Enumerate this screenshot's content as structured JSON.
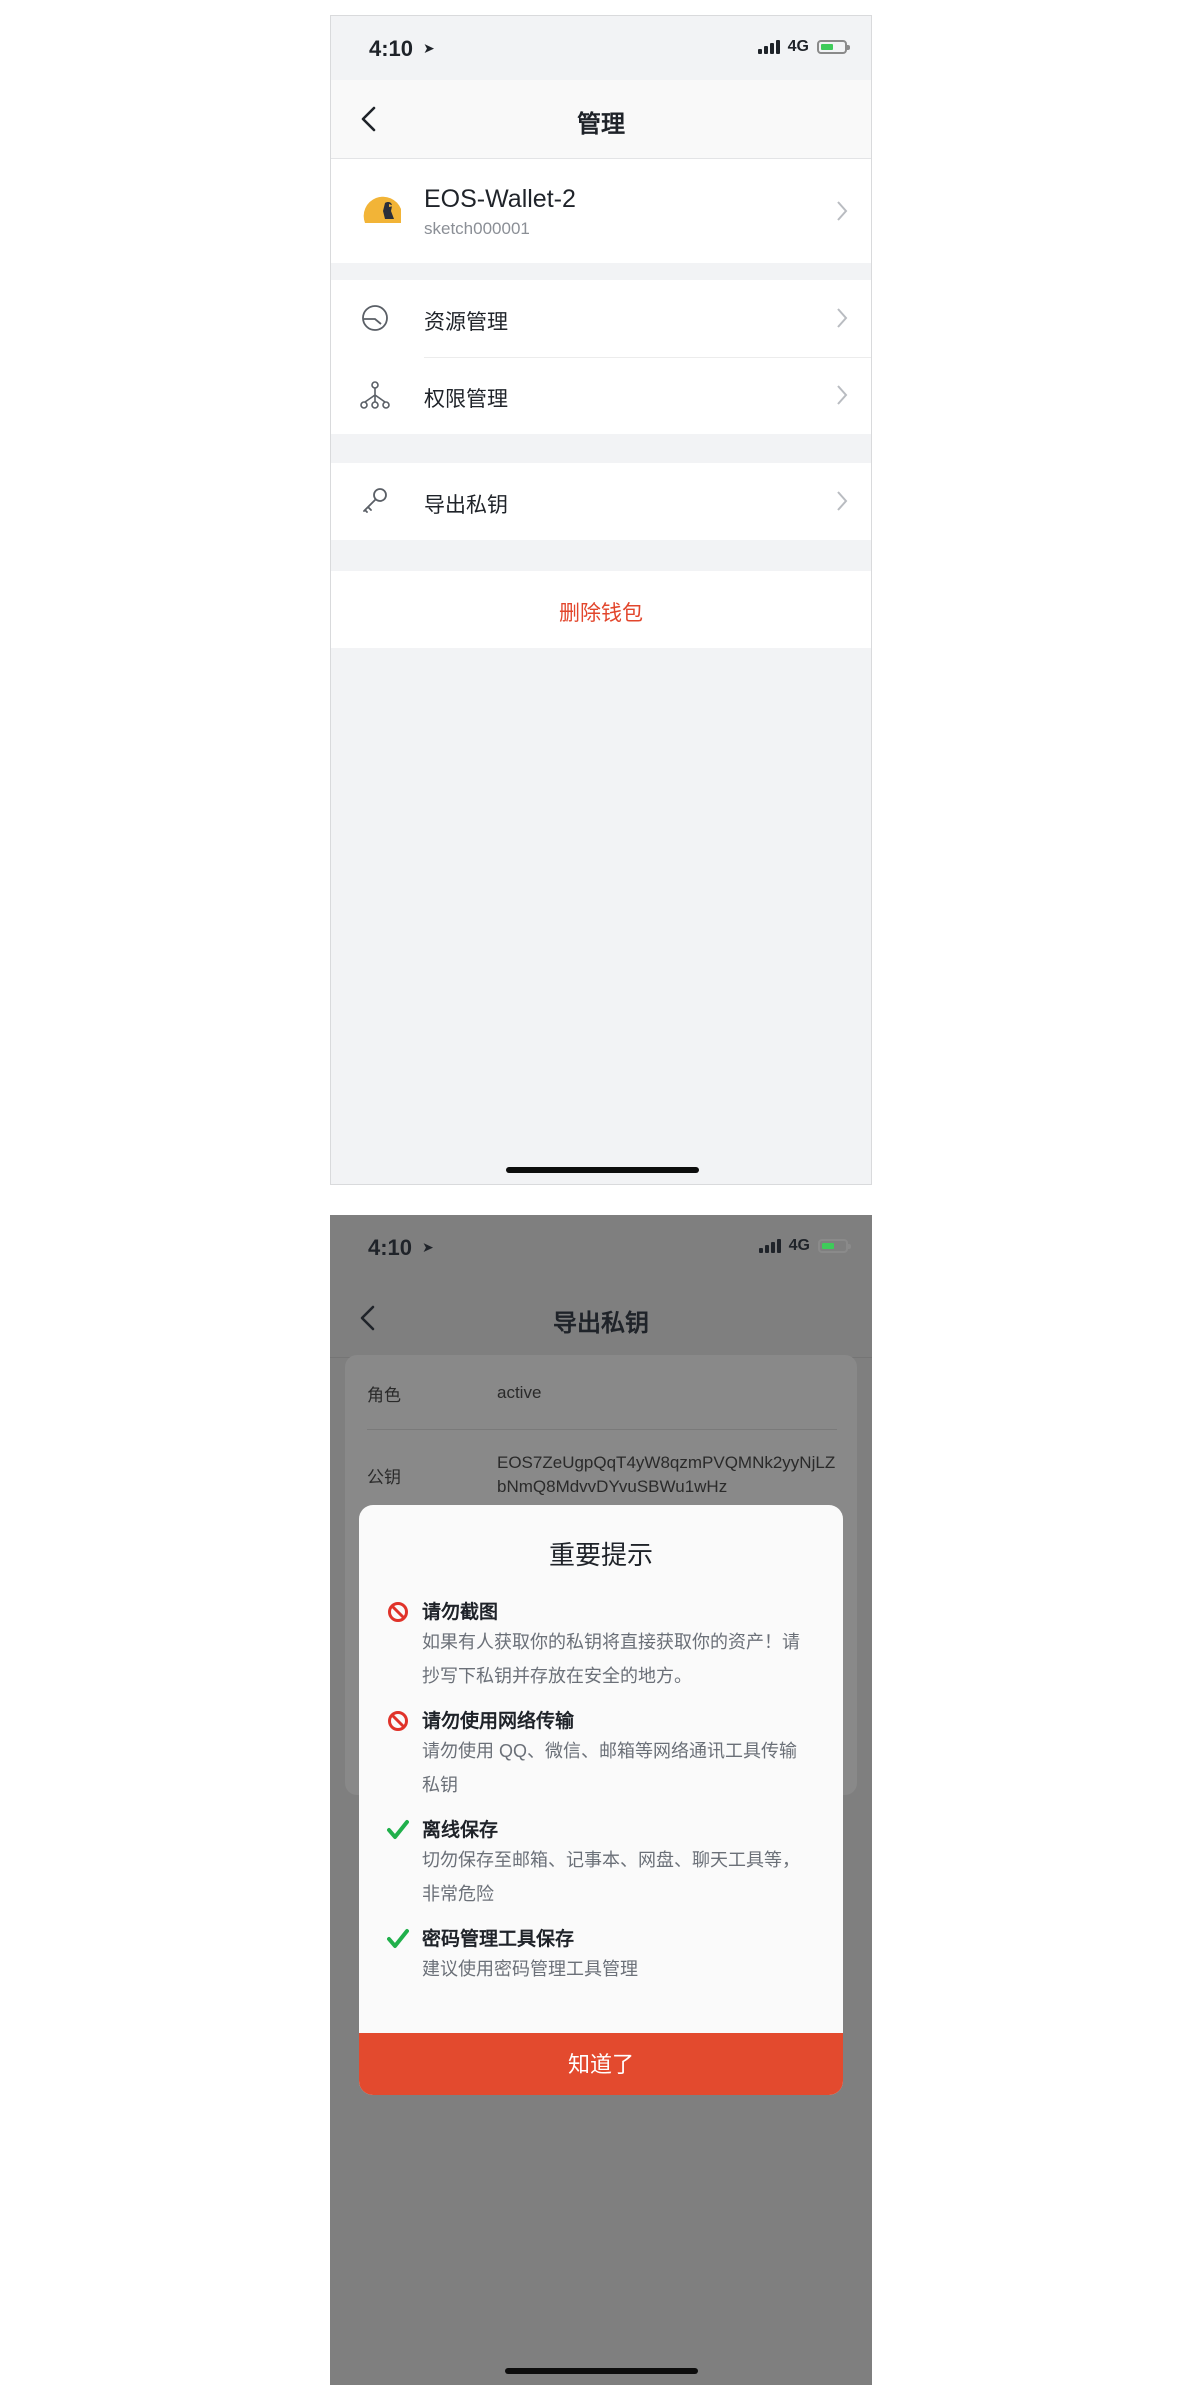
{
  "screen1": {
    "status": {
      "time": "4:10",
      "network": "4G"
    },
    "nav": {
      "title": "管理"
    },
    "wallet": {
      "name": "EOS-Wallet-2",
      "account": "sketch000001"
    },
    "menu": [
      {
        "label": "资源管理",
        "icon": "gauge-icon"
      },
      {
        "label": "权限管理",
        "icon": "hierarchy-icon"
      },
      {
        "label": "导出私钥",
        "icon": "key-icon"
      }
    ],
    "delete_label": "删除钱包"
  },
  "screen2": {
    "status": {
      "time": "4:10",
      "network": "4G"
    },
    "nav": {
      "title": "导出私钥"
    },
    "info": {
      "role_label": "角色",
      "role_value": "active",
      "pubkey_label": "公钥",
      "pubkey_value": "EOS7ZeUgpQqT4yW8qzmPVQMNk2yyNjLZbNmQ8MdvvDYvuSBWu1wHz"
    },
    "dialog": {
      "title": "重要提示",
      "tips": [
        {
          "title": "请勿截图",
          "body": "如果有人获取你的私钥将直接获取你的资产！请抄写下私钥并存放在安全的地方。",
          "icon": "prohibited-icon"
        },
        {
          "title": "请勿使用网络传输",
          "body": "请勿使用 QQ、微信、邮箱等网络通讯工具传输私钥",
          "icon": "prohibited-icon"
        },
        {
          "title": "离线保存",
          "body": "切勿保存至邮箱、记事本、网盘、聊天工具等，非常危险",
          "icon": "checkmark-icon"
        },
        {
          "title": "密码管理工具保存",
          "body": "建议使用密码管理工具管理",
          "icon": "checkmark-icon"
        }
      ],
      "button": "知道了"
    }
  },
  "colors": {
    "accent": "#e34a2e",
    "danger_text": "#e2462c",
    "check": "#20b04b",
    "overlay": "#7f7f7f"
  }
}
